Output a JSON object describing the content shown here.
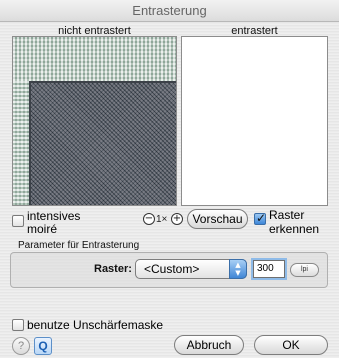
{
  "window": {
    "title": "Entrasterung"
  },
  "preview": {
    "left_label": "nicht entrastert",
    "right_label": "entrastert"
  },
  "options": {
    "intensive_moire_line1": "intensives",
    "intensive_moire_line2": "moiré",
    "intensive_moire_checked": false,
    "zoom_out_symbol": "−",
    "zoom_level": "1×",
    "zoom_in_symbol": "+",
    "preview_button": "Vorschau",
    "detect_screen_line1": "Raster",
    "detect_screen_line2": "erkennen",
    "detect_screen_checked": true
  },
  "parameters": {
    "section_label": "Parameter für Entrasterung",
    "raster_label": "Raster:",
    "raster_value": "<Custom>",
    "raster_number": "300",
    "unit_button": "lpi"
  },
  "footer": {
    "unsharp_mask_label": "benutze Unschärfemaske",
    "unsharp_mask_checked": false,
    "help_symbol": "?",
    "info_symbol": "Q",
    "cancel_button": "Abbruch",
    "ok_button": "OK"
  }
}
